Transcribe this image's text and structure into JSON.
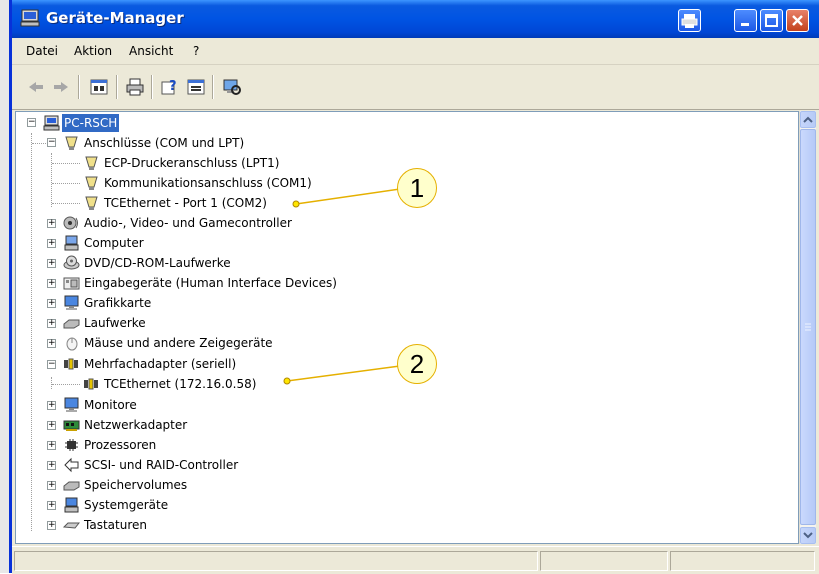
{
  "window": {
    "title": "Geräte-Manager"
  },
  "menu": {
    "items": [
      "Datei",
      "Aktion",
      "Ansicht",
      "?"
    ]
  },
  "toolbar": {
    "buttons": [
      "back-icon",
      "forward-icon",
      "properties-icon",
      "print-icon",
      "help-icon",
      "view-icon",
      "scan-hardware-icon"
    ]
  },
  "tree": {
    "root": "PC-RSCH",
    "ports_group": "Anschlüsse (COM und LPT)",
    "ports_children": [
      "ECP-Druckeranschluss (LPT1)",
      "Kommunikationsanschluss (COM1)",
      "TCEthernet - Port 1 (COM2)"
    ],
    "categories_a": [
      "Audio-, Video- und Gamecontroller",
      "Computer",
      "DVD/CD-ROM-Laufwerke",
      "Eingabegeräte (Human Interface Devices)",
      "Grafikkarte",
      "Laufwerke",
      "Mäuse und andere Zeigegeräte"
    ],
    "multiport_group": "Mehrfachadapter (seriell)",
    "multiport_children": [
      "TCEthernet (172.16.0.58)"
    ],
    "categories_b": [
      "Monitore",
      "Netzwerkadapter",
      "Prozessoren",
      "SCSI- und RAID-Controller",
      "Speichervolumes",
      "Systemgeräte",
      "Tastaturen"
    ]
  },
  "callouts": [
    "1",
    "2"
  ],
  "colors": {
    "title_bar": "#0054e3",
    "selection": "#316ac5",
    "callout_fill": "#ffffcc",
    "callout_line": "#e5b000"
  }
}
